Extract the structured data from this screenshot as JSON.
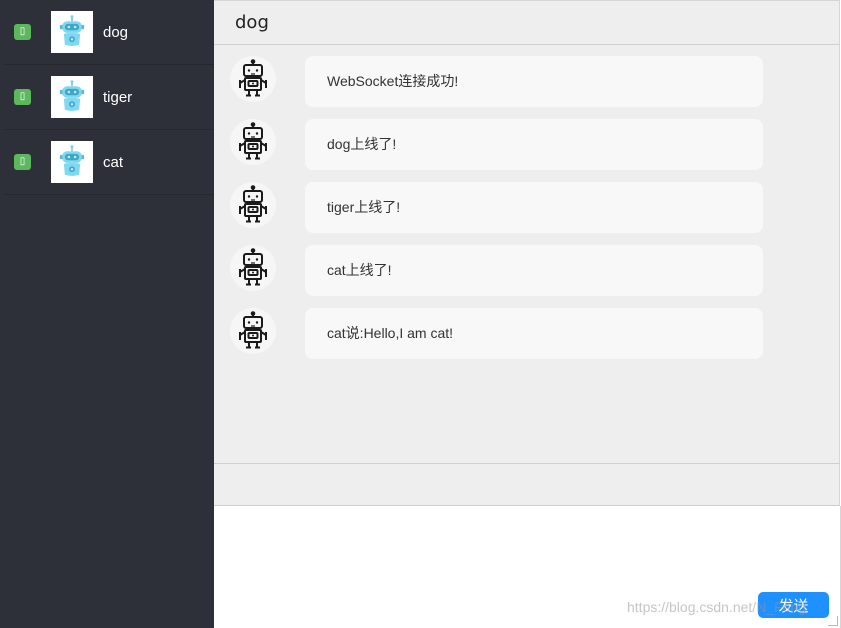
{
  "sidebar": {
    "contacts": [
      {
        "name": "dog",
        "status_icon": "status-square-icon",
        "avatar_icon": "robot-icon"
      },
      {
        "name": "tiger",
        "status_icon": "status-square-icon",
        "avatar_icon": "robot-icon"
      },
      {
        "name": "cat",
        "status_icon": "status-square-icon",
        "avatar_icon": "robot-icon"
      }
    ],
    "status_color": "#5cb85c",
    "background": "#2d3038"
  },
  "chat": {
    "title": "dog",
    "messages": [
      {
        "text": "WebSocket连接成功!",
        "avatar_icon": "robot-icon"
      },
      {
        "text": "dog上线了!",
        "avatar_icon": "robot-icon"
      },
      {
        "text": "tiger上线了!",
        "avatar_icon": "robot-icon"
      },
      {
        "text": "cat上线了!",
        "avatar_icon": "robot-icon"
      },
      {
        "text": "cat说:Hello,I am cat!",
        "avatar_icon": "robot-icon"
      }
    ]
  },
  "composer": {
    "value": "",
    "send_label": "发送",
    "send_color": "#1e90ff"
  },
  "watermark": "https://blog.csdn.net/N_Feng"
}
